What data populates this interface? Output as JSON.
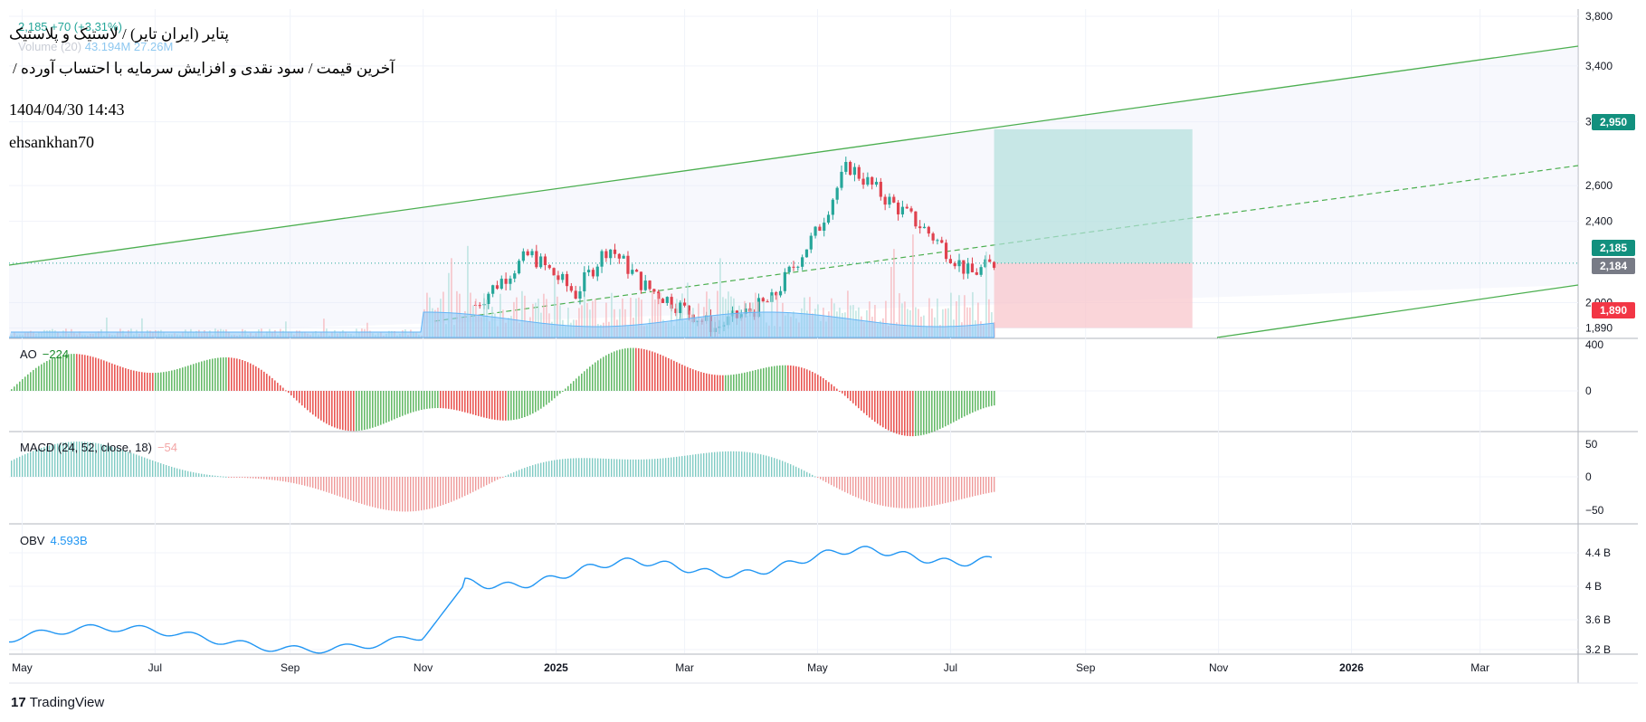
{
  "header": {
    "symbol_title": "پتایر (ایران تایر) / لاستیک و پلاستیک",
    "subtitle": "آخرین قیمت / سود نقدی و افزایش سرمایه با احتساب آورده /",
    "datetime": "1404/04/30 14:43",
    "author": "ehsankhan70"
  },
  "legend": {
    "price_change": "2,185  +70 (+3.31%)",
    "volume_label": "Volume (20)",
    "volume_values": "43.194M  27.26M",
    "ao_label": "AO",
    "ao_value": "−224",
    "macd_label": "MACD (24, 52, close, 18)",
    "macd_value": "−54",
    "obv_label": "OBV",
    "obv_value": "4.593B"
  },
  "price_tags": {
    "take_profit": "2,950",
    "last_price": "2,185",
    "prev_close": "2,184",
    "stop_loss": "1,890"
  },
  "brand": {
    "logo": "17",
    "name": "TradingView"
  },
  "colors": {
    "up": "#26a69a",
    "down": "#ef5350",
    "candle_up": "#26a69a",
    "candle_down": "#e0424f",
    "channel": "#4caf50",
    "obv": "#2196f3",
    "volume_ma": "#90caf9",
    "target_zone": "#b2dfdb",
    "stop_zone": "#f8c7cc"
  },
  "chart_data": [
    {
      "type": "candlestick",
      "panel": "price",
      "scale": "log",
      "x_ticks": [
        "May",
        "Jul",
        "Sep",
        "Nov",
        "2025",
        "Mar",
        "May",
        "Jul",
        "Sep",
        "Nov",
        "2026",
        "Mar"
      ],
      "y_ticks": [
        "3,800",
        "3,400",
        "3,000",
        "2,600",
        "2,400",
        "2,000",
        "1,890"
      ],
      "ylim": [
        1850,
        3800
      ],
      "close_series": [
        {
          "date": "2024-11-25",
          "close": 1990
        },
        {
          "date": "2024-12-20",
          "close": 2230
        },
        {
          "date": "2025-01-10",
          "close": 2040
        },
        {
          "date": "2025-01-25",
          "close": 2270
        },
        {
          "date": "2025-02-10",
          "close": 2080
        },
        {
          "date": "2025-03-01",
          "close": 1970
        },
        {
          "date": "2025-03-15",
          "close": 1890
        },
        {
          "date": "2025-04-10",
          "close": 2010
        },
        {
          "date": "2025-05-01",
          "close": 2350
        },
        {
          "date": "2025-05-15",
          "close": 2720
        },
        {
          "date": "2025-06-01",
          "close": 2530
        },
        {
          "date": "2025-06-20",
          "close": 2350
        },
        {
          "date": "2025-07-10",
          "close": 2130
        },
        {
          "date": "2025-07-21",
          "close": 2185
        }
      ],
      "last": 2185,
      "change": 70,
      "change_pct": 3.31,
      "trade_box": {
        "entry": 2185,
        "target": 2950,
        "stop": 1890,
        "start": "2025-07-21",
        "end": "2025-10-20"
      }
    },
    {
      "type": "bar",
      "panel": "AO",
      "y_ticks": [
        "400",
        "0"
      ],
      "last": -224
    },
    {
      "type": "bar",
      "panel": "MACD (24, 52, close, 18)",
      "y_ticks": [
        "50",
        "0",
        "−50"
      ],
      "last": -54
    },
    {
      "type": "line",
      "panel": "OBV",
      "y_ticks": [
        "4.4 B",
        "4 B",
        "3.6 B",
        "3.2 B"
      ],
      "last": "4.593B"
    }
  ]
}
